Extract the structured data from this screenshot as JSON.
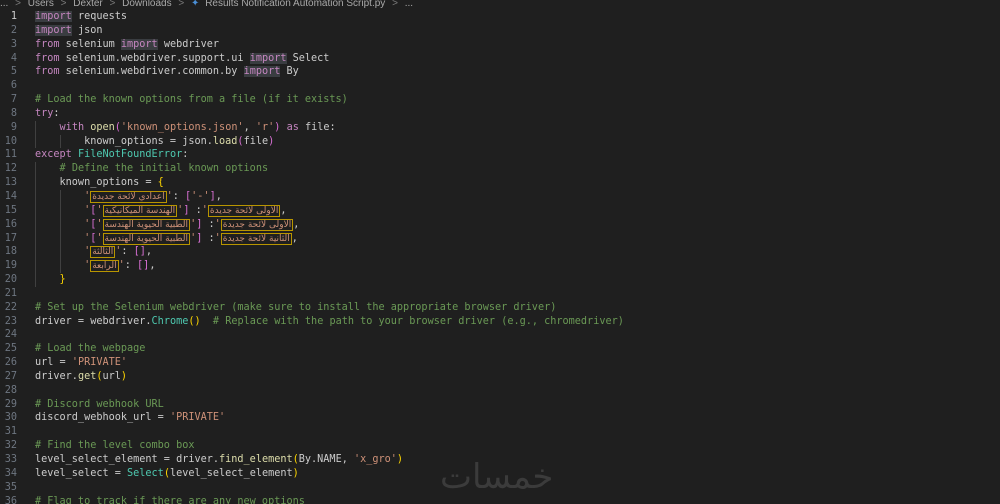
{
  "breadcrumb": {
    "lead": "...",
    "items": [
      "Users",
      "Dexter",
      "Downloads"
    ],
    "file": "Results Notification Automation Script.py",
    "tail": "..."
  },
  "watermark": "خمسات",
  "lines": [
    {
      "n": "1",
      "tokens": [
        {
          "c": "kwhl",
          "t": "import"
        },
        {
          "t": " requests"
        }
      ]
    },
    {
      "n": "2",
      "tokens": [
        {
          "c": "kwhl",
          "t": "import"
        },
        {
          "t": " json"
        }
      ]
    },
    {
      "n": "3",
      "tokens": [
        {
          "c": "kw",
          "t": "from"
        },
        {
          "t": " selenium "
        },
        {
          "c": "kwhl",
          "t": "import"
        },
        {
          "t": " webdriver"
        }
      ]
    },
    {
      "n": "4",
      "tokens": [
        {
          "c": "kw",
          "t": "from"
        },
        {
          "t": " selenium.webdriver.support.ui "
        },
        {
          "c": "kwhl",
          "t": "import"
        },
        {
          "t": " Select"
        }
      ]
    },
    {
      "n": "5",
      "tokens": [
        {
          "c": "kw",
          "t": "from"
        },
        {
          "t": " selenium.webdriver.common.by "
        },
        {
          "c": "kwhl",
          "t": "import"
        },
        {
          "t": " By"
        }
      ]
    },
    {
      "n": "6",
      "tokens": []
    },
    {
      "n": "7",
      "tokens": [
        {
          "c": "cm",
          "t": "# Load the known options from a file (if it exists)"
        }
      ]
    },
    {
      "n": "8",
      "tokens": [
        {
          "c": "kw",
          "t": "try"
        },
        {
          "t": ":"
        }
      ]
    },
    {
      "n": "9",
      "tokens": [
        {
          "t": "    "
        },
        {
          "c": "kw",
          "t": "with"
        },
        {
          "t": " "
        },
        {
          "c": "fn",
          "t": "open"
        },
        {
          "c": "br2",
          "t": "("
        },
        {
          "c": "str",
          "t": "'known_options.json'"
        },
        {
          "t": ", "
        },
        {
          "c": "str",
          "t": "'r'"
        },
        {
          "c": "br2",
          "t": ")"
        },
        {
          "t": " "
        },
        {
          "c": "kw",
          "t": "as"
        },
        {
          "t": " file:"
        }
      ]
    },
    {
      "n": "10",
      "tokens": [
        {
          "t": "        known_options = json."
        },
        {
          "c": "fn",
          "t": "load"
        },
        {
          "c": "br2",
          "t": "("
        },
        {
          "t": "file"
        },
        {
          "c": "br2",
          "t": ")"
        }
      ]
    },
    {
      "n": "11",
      "tokens": [
        {
          "c": "kw",
          "t": "except"
        },
        {
          "t": " "
        },
        {
          "c": "cls",
          "t": "FileNotFoundError"
        },
        {
          "t": ":"
        }
      ]
    },
    {
      "n": "12",
      "tokens": [
        {
          "t": "    "
        },
        {
          "c": "cm",
          "t": "# Define the initial known options"
        }
      ]
    },
    {
      "n": "13",
      "tokens": [
        {
          "t": "    known_options = "
        },
        {
          "c": "br1",
          "t": "{"
        }
      ]
    },
    {
      "n": "14",
      "tokens": [
        {
          "t": "        "
        },
        {
          "c": "str",
          "t": "'"
        },
        {
          "c": "ar",
          "t": "اعدادي لائحة جديدة"
        },
        {
          "c": "str",
          "t": "'"
        },
        {
          "t": ": "
        },
        {
          "c": "br2",
          "t": "["
        },
        {
          "c": "str",
          "t": "'-'"
        },
        {
          "c": "br2",
          "t": "]"
        },
        {
          "t": ","
        }
      ]
    },
    {
      "n": "15",
      "tokens": [
        {
          "t": "        "
        },
        {
          "c": "str",
          "t": "'"
        },
        {
          "c": "ar",
          "t": "الاولى لائحة جديدة"
        },
        {
          "c": "str",
          "t": "'"
        },
        {
          "t": ": "
        },
        {
          "c": "br2",
          "t": "["
        },
        {
          "c": "str",
          "t": "'"
        },
        {
          "c": "ar",
          "t": "الهندسة الميكانيكية"
        },
        {
          "c": "str",
          "t": "'"
        },
        {
          "c": "br2",
          "t": "]"
        },
        {
          "t": ","
        }
      ]
    },
    {
      "n": "16",
      "tokens": [
        {
          "t": "        "
        },
        {
          "c": "str",
          "t": "'"
        },
        {
          "c": "ar",
          "t": "الاولى لائحة جديدة"
        },
        {
          "c": "str",
          "t": "'"
        },
        {
          "t": ": "
        },
        {
          "c": "br2",
          "t": "["
        },
        {
          "c": "str",
          "t": "'"
        },
        {
          "c": "ar",
          "t": "الطبية الحيوية الهندسة"
        },
        {
          "c": "str",
          "t": "'"
        },
        {
          "c": "br2",
          "t": "]"
        },
        {
          "t": ","
        }
      ]
    },
    {
      "n": "17",
      "tokens": [
        {
          "t": "        "
        },
        {
          "c": "str",
          "t": "'"
        },
        {
          "c": "ar",
          "t": "الثانية لائحة جديدة"
        },
        {
          "c": "str",
          "t": "'"
        },
        {
          "t": ": "
        },
        {
          "c": "br2",
          "t": "["
        },
        {
          "c": "str",
          "t": "'"
        },
        {
          "c": "ar",
          "t": "الطبية الحيوية الهندسة"
        },
        {
          "c": "str",
          "t": "'"
        },
        {
          "c": "br2",
          "t": "]"
        },
        {
          "t": ","
        }
      ]
    },
    {
      "n": "18",
      "tokens": [
        {
          "t": "        "
        },
        {
          "c": "str",
          "t": "'"
        },
        {
          "c": "ar",
          "t": "الثالثة"
        },
        {
          "c": "str",
          "t": "'"
        },
        {
          "t": ": "
        },
        {
          "c": "br2",
          "t": "[]"
        },
        {
          "t": ","
        }
      ]
    },
    {
      "n": "19",
      "tokens": [
        {
          "t": "        "
        },
        {
          "c": "str",
          "t": "'"
        },
        {
          "c": "ar",
          "t": "الرابعة"
        },
        {
          "c": "str",
          "t": "'"
        },
        {
          "t": ": "
        },
        {
          "c": "br2",
          "t": "[]"
        },
        {
          "t": ","
        }
      ]
    },
    {
      "n": "20",
      "tokens": [
        {
          "t": "    "
        },
        {
          "c": "br1",
          "t": "}"
        }
      ]
    },
    {
      "n": "21",
      "tokens": []
    },
    {
      "n": "22",
      "tokens": [
        {
          "c": "cm",
          "t": "# Set up the Selenium webdriver (make sure to install the appropriate browser driver)"
        }
      ]
    },
    {
      "n": "23",
      "tokens": [
        {
          "t": "driver = webdriver."
        },
        {
          "c": "cls",
          "t": "Chrome"
        },
        {
          "c": "br1",
          "t": "()"
        },
        {
          "t": "  "
        },
        {
          "c": "cm",
          "t": "# Replace with the path to your browser driver (e.g., chromedriver)"
        }
      ]
    },
    {
      "n": "24",
      "tokens": []
    },
    {
      "n": "25",
      "tokens": [
        {
          "c": "cm",
          "t": "# Load the webpage"
        }
      ]
    },
    {
      "n": "26",
      "tokens": [
        {
          "t": "url = "
        },
        {
          "c": "str",
          "t": "'PRIVATE'"
        }
      ]
    },
    {
      "n": "27",
      "tokens": [
        {
          "t": "driver."
        },
        {
          "c": "fn",
          "t": "get"
        },
        {
          "c": "br1",
          "t": "("
        },
        {
          "t": "url"
        },
        {
          "c": "br1",
          "t": ")"
        }
      ]
    },
    {
      "n": "28",
      "tokens": []
    },
    {
      "n": "29",
      "tokens": [
        {
          "c": "cm",
          "t": "# Discord webhook URL"
        }
      ]
    },
    {
      "n": "30",
      "tokens": [
        {
          "t": "discord_webhook_url = "
        },
        {
          "c": "str",
          "t": "'PRIVATE'"
        }
      ]
    },
    {
      "n": "31",
      "tokens": []
    },
    {
      "n": "32",
      "tokens": [
        {
          "c": "cm",
          "t": "# Find the level combo box"
        }
      ]
    },
    {
      "n": "33",
      "tokens": [
        {
          "t": "level_select_element = driver."
        },
        {
          "c": "fn",
          "t": "find_element"
        },
        {
          "c": "br1",
          "t": "("
        },
        {
          "t": "By.NAME, "
        },
        {
          "c": "str",
          "t": "'x_gro'"
        },
        {
          "c": "br1",
          "t": ")"
        }
      ]
    },
    {
      "n": "34",
      "tokens": [
        {
          "t": "level_select = "
        },
        {
          "c": "cls",
          "t": "Select"
        },
        {
          "c": "br1",
          "t": "("
        },
        {
          "t": "level_select_element"
        },
        {
          "c": "br1",
          "t": ")"
        }
      ]
    },
    {
      "n": "35",
      "tokens": []
    },
    {
      "n": "36",
      "tokens": [
        {
          "c": "cm",
          "t": "# Flag to track if there are any new options"
        }
      ]
    }
  ]
}
